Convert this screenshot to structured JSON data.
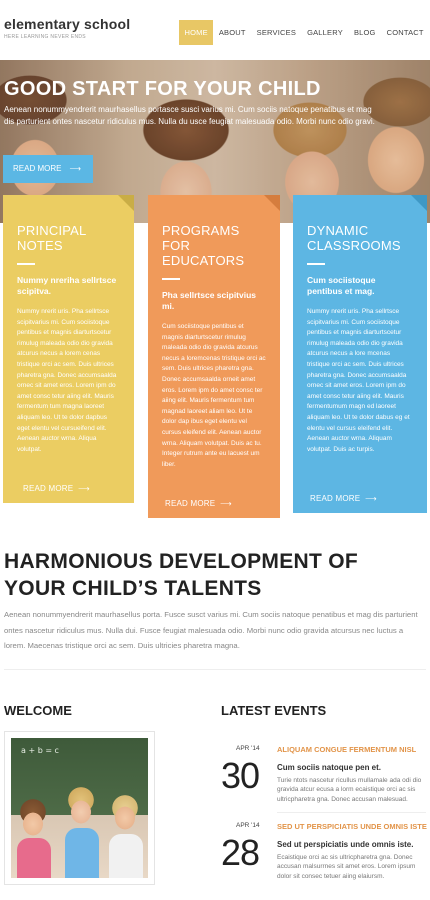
{
  "header": {
    "logo": "elementary school",
    "tagline": "HERE LEARNING NEVER ENDS",
    "nav": [
      {
        "label": "HOME",
        "active": true
      },
      {
        "label": "ABOUT"
      },
      {
        "label": "SERVICES"
      },
      {
        "label": "GALLERY"
      },
      {
        "label": "BLOG"
      },
      {
        "label": "CONTACT"
      }
    ]
  },
  "hero": {
    "title": "GOOD START FOR YOUR CHILD",
    "text": "Aenean nonummyendrerit maurhasellus portasce susci varius mi. Cum sociis natoque penatibus et mag dis parturient ontes nascetur ridiculus mus. Nulla du usce feugiat malesuada odio. Morbi nunc odio gravi.",
    "button": "READ MORE",
    "button_arrow": "⟶"
  },
  "cards": [
    {
      "title": "PRINCIPAL NOTES",
      "subtitle": "Nummy nreriha sellrtsce scipitva.",
      "body": "Nummy nrerit uris. Pha sellrtsce scipitvarius mi. Cum sociistoque pentibus et magnis diarturtscetur rimulug maleada odio dio gravida atcurus necus a lorem cenas tristique orci ac sem. Duis ultrices pharetra gna. Donec accumsaalda ornec sit amet eros. Lorem ipm do amet consc tetur aiing elit. Mauris fermentum tum magna laoreet aliquam leo. Ut te dolor dapbus eget elentu vel cursueifend elit. Aenean auctor wrna. Aliqua volutpat.",
      "more": "READ MORE",
      "color": "#ebcd62"
    },
    {
      "title": "PROGRAMS FOR EDUCATORS",
      "subtitle": "Pha sellrtsce scipitvius mi.",
      "body": "Cum sociistoque pentibus et magnis diarturtscetur rimulug maleada odio dio gravida atcurus necus a loremcenas tristique orci ac sem. Duis ultrices pharetra gna. Donec accumsaalda orneit amet eros. Lorem ipm do amet consc ter aiing elit. Mauris fermentum tum magnad laoreet aliam leo. Ut te dolor dap ibus eget elentu vel cursus eleifend elit. Aenean auctor wrna. Aliquam volutpat. Duis ac tu. Integer rutrum ante eu lacuest um liber.",
      "more": "READ MORE",
      "color": "#f09a5a"
    },
    {
      "title": "DYNAMIC CLASSROOMS",
      "subtitle": "Cum sociistoque pentibus et mag.",
      "body": "Nummy nrerit uris. Pha sellrtsce scipitvarius mi. Cum sociistoque pentibus et magnis diarturtscetur rimulug maleada odio dio gravida atcurus necus a lore mcenas tristique orci ac sem. Duis ultrices pharetra gna. Donec accumsaalda ornec sit amet eros. Lorem ipm do amet consc tetur aiing elit. Mauris fermentumum magn ed laoreet aliquam leo. Ut te dolor dabus eg et elentu vel cursus eleifend elit. Aenean auctor wrna. Aliquam volutpat. Duis ac turpis.",
      "more": "READ MORE",
      "color": "#5db6e3"
    }
  ],
  "intro": {
    "title": "HARMONIOUS DEVELOPMENT OF YOUR CHILD’S TALENTS",
    "text": "Aenean nonummyendrerit maurhasellus porta. Fusce susct varius mi. Cum sociis natoque penatibus et mag dis parturient ontes nascetur ridiculus mus. Nulla dui. Fusce feugiat malesuada odio. Morbi nunc odio gravida atcursus nec luctus a lorem. Maecenas tristique orci ac sem. Duis ultricies pharetra magna."
  },
  "welcome": {
    "title": "WELCOME",
    "chalk_text": "a + b = c"
  },
  "events": {
    "title": "LATEST EVENTS",
    "items": [
      {
        "month": "APR '14",
        "day": "30",
        "headline": "ALIQUAM CONGUE FERMENTUM NISL",
        "subhead": "Cum sociis natoque pen et.",
        "desc": "Turie ntots nascetur ricullus mullamale ada odi dio gravida atcur ecusa a lorm ecaistique orci ac sis ultricpharetra gna. Donec accusan malesuad."
      },
      {
        "month": "APR '14",
        "day": "28",
        "headline": "SED UT PERSPICIATIS UNDE OMNIS ISTE",
        "subhead": "Sed ut perspiciatis unde omnis iste.",
        "desc": "Ecaistique orci ac sis ultricpharetra gna. Donec accusan malsurrnes sit amet eros. Lorem ipsum dolor sit consec tetuer aiing elaiursm."
      }
    ]
  }
}
